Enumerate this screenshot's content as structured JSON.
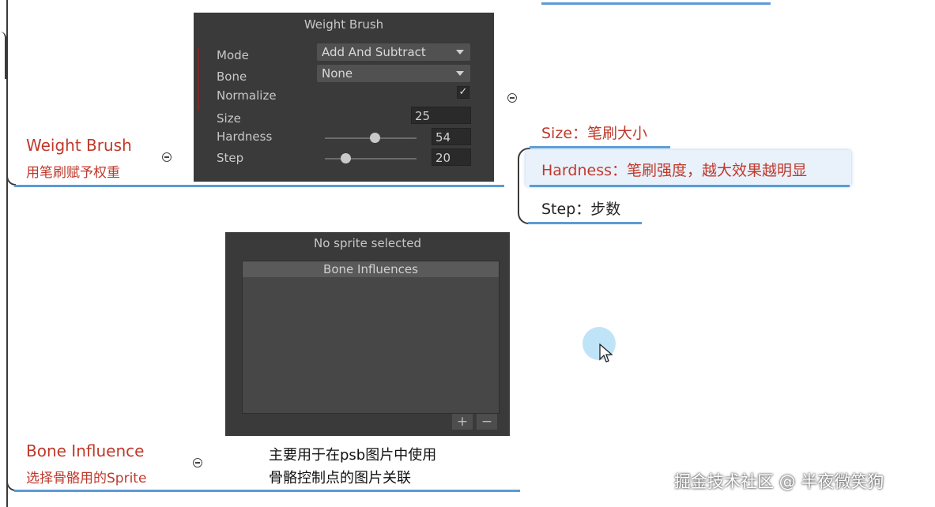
{
  "weight_brush_node": {
    "title": "Weight Brush",
    "subtitle": "用笔刷赋予权重"
  },
  "weight_brush_panel": {
    "title": "Weight Brush",
    "mode_label": "Mode",
    "mode_value": "Add And Subtract",
    "bone_label": "Bone",
    "bone_value": "None",
    "normalize_label": "Normalize",
    "normalize_checked": true,
    "size_label": "Size",
    "size_value": "25",
    "hardness_label": "Hardness",
    "hardness_value": "54",
    "step_label": "Step",
    "step_value": "20"
  },
  "right_notes": {
    "size": "Size：笔刷大小",
    "hardness": "Hardness：笔刷强度，越大效果越明显",
    "step": "Step：步数"
  },
  "bone_panel": {
    "title": "No sprite selected",
    "list_header": "Bone Influences",
    "add_button": "+",
    "remove_button": "−"
  },
  "bone_influence_node": {
    "title": "Bone Influence",
    "subtitle": "选择骨骼用的Sprite"
  },
  "bone_description": {
    "line1": "主要用于在psb图片中使用",
    "line2": "骨骼控制点的图片关联"
  },
  "watermark": "掘金技术社区 @ 半夜微笑狗",
  "colors": {
    "accent_red": "#c0392b",
    "connector_blue": "#5b9bd5",
    "panel_bg": "#3a3a3a"
  }
}
